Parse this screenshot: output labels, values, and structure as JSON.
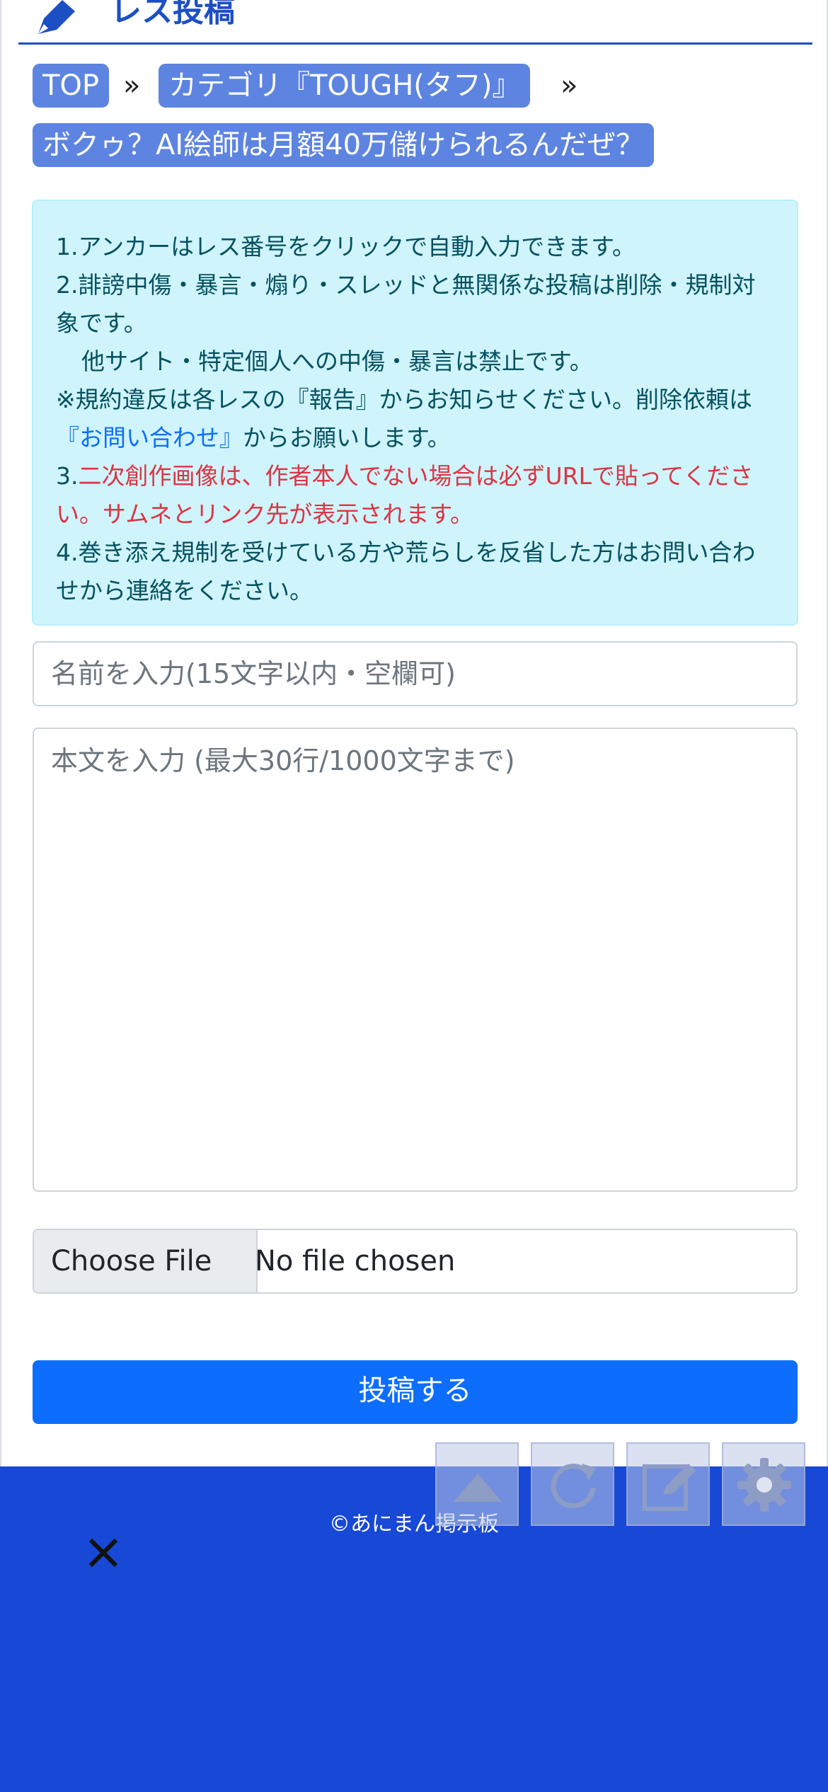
{
  "header": {
    "title": "レス投稿",
    "icon": "pencil-icon"
  },
  "breadcrumb": {
    "items": [
      "TOP",
      "カテゴリ『TOUGH(タフ)』",
      "ボクゥ？AI絵師は月額40万儲けられるんだぜ？"
    ],
    "separator": "»"
  },
  "notice": {
    "line1": "1.アンカーはレス番号をクリックで自動入力できます。",
    "line2": "2.誹謗中傷・暴言・煽り・スレッドと無関係な投稿は削除・規制対象です。",
    "line3": "他サイト・特定個人への中傷・暴言は禁止です。",
    "line4_pre": "※規約違反は各レスの『報告』からお知らせください。削除依頼は",
    "line4_link": "『お問い合わせ』",
    "line4_post": "からお願いします。",
    "line5_num": "3.",
    "line5_red": "二次創作画像は、作者本人でない場合は必ずURLで貼ってください。サムネとリンク先が表示されます。",
    "line6": "4.巻き添え規制を受けている方や荒らしを反省した方はお問い合わせから連絡をください。"
  },
  "form": {
    "name_placeholder": "名前を入力(15文字以内・空欄可)",
    "name_value": "",
    "body_placeholder": "本文を入力 (最大30行/1000文字まで)",
    "body_value": "",
    "file_button": "Choose File",
    "file_status": "No file chosen",
    "submit_label": "投稿する"
  },
  "footer": {
    "copyright": "©あにまん掲示板",
    "close_icon": "close-icon"
  },
  "fab": [
    "scroll-top-icon",
    "reload-icon",
    "edit-icon",
    "settings-icon"
  ],
  "colors": {
    "brand": "#1d4fc4",
    "footer": "#1748d6",
    "breadcrumb": "#5d84e0",
    "primary": "#0d6efd",
    "alert_bg": "#cff4fc",
    "danger": "#dc3545"
  }
}
